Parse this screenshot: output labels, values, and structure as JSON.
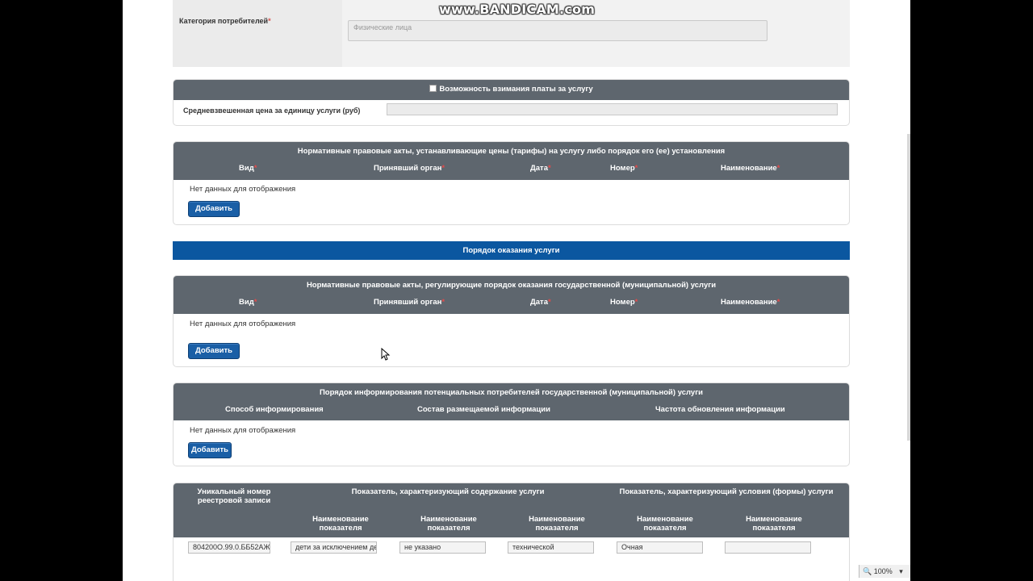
{
  "watermark": "www.BANDICAM.com",
  "category": {
    "label": "Категория потребителей",
    "required_mark": "*",
    "value": "Физические лица"
  },
  "fee": {
    "checkbox_label": "Возможность взимания платы за услугу",
    "checked": false,
    "price_label": "Средневзвешенная цена за единицу услуги (руб)",
    "price_value": ""
  },
  "tariff_acts": {
    "title": "Нормативные правовые акты, устанавливающие цены (тарифы) на услугу либо порядок его (ее) установления",
    "columns": [
      "Вид",
      "Принявший орган",
      "Дата",
      "Номер",
      "Наименование"
    ],
    "required_mark": "*",
    "empty_text": "Нет данных для отображения",
    "add_button": "Добавить"
  },
  "service_order": {
    "title": "Порядок оказания услуги"
  },
  "regulating_acts": {
    "title": "Нормативные правовые акты, регулирующие порядок оказания государственной (муниципальной) услуги",
    "columns": [
      "Вид",
      "Принявший орган",
      "Дата",
      "Номер",
      "Наименование"
    ],
    "required_mark": "*",
    "empty_text": "Нет данных для отображения",
    "add_button": "Добавить"
  },
  "informing": {
    "title": "Порядок информирования потенциальных потребителей государственной (муниципальной) услуги",
    "columns": [
      "Способ информирования",
      "Состав размещаемой информации",
      "Частота обновления информации"
    ],
    "empty_text": "Нет данных для отображения",
    "add_button": "Добавить"
  },
  "indicators": {
    "unique_number_header": "Уникальный номер реестровой записи",
    "content_header": "Показатель, характеризующий содержание услуги",
    "conditions_header": "Показатель, характеризующий условия (формы) услуги",
    "sub_header": "Наименование показателя",
    "row": [
      "804200О.99.0.ББ52АЖ",
      "дети за исключением детей",
      "не указано",
      "технической",
      "Очная",
      ""
    ]
  },
  "zoom": "100%"
}
